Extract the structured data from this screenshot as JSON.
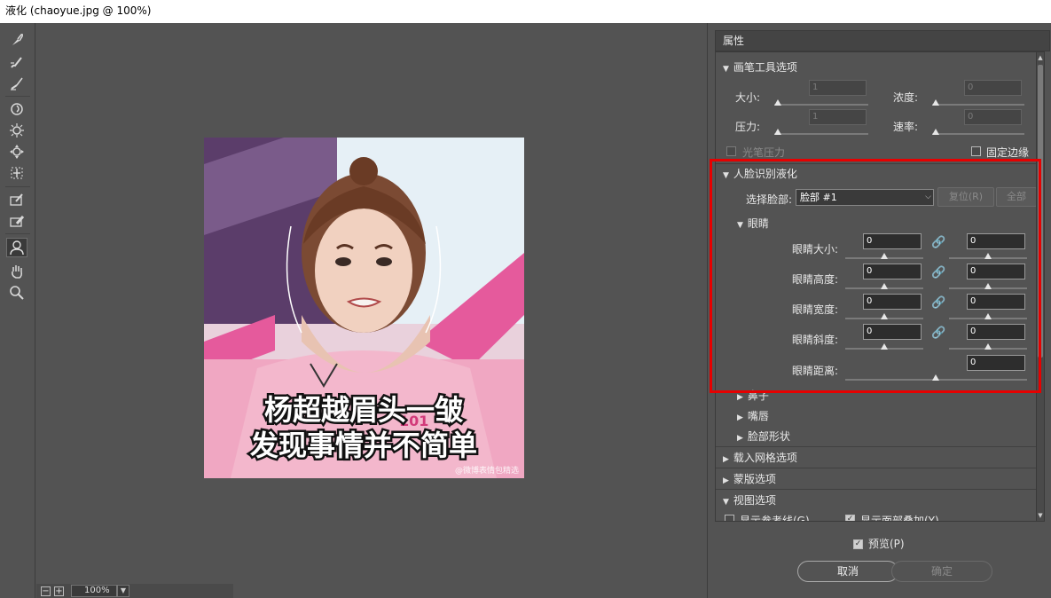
{
  "window": {
    "title": "液化 (chaoyue.jpg @ 100%)"
  },
  "toolbar": {
    "tools": [
      {
        "icon": "forward-warp-icon"
      },
      {
        "icon": "reconstruct-icon"
      },
      {
        "icon": "smooth-icon"
      },
      {
        "icon": "twirl-icon"
      },
      {
        "icon": "pucker-icon"
      },
      {
        "icon": "bloat-icon"
      },
      {
        "icon": "push-left-icon"
      },
      {
        "icon": "freeze-mask-icon"
      },
      {
        "icon": "thaw-mask-icon"
      },
      {
        "icon": "face-tool-icon",
        "active": true
      },
      {
        "icon": "hand-icon"
      },
      {
        "icon": "zoom-icon"
      }
    ]
  },
  "canvas": {
    "caption_line1": "杨超越眉头一皱",
    "caption_line2": "发现事情并不简单",
    "logo_text": "101",
    "watermark": "@微博表情包精选"
  },
  "zoom": {
    "value": "100%"
  },
  "properties": {
    "header": "属性",
    "brush_section": {
      "title": "画笔工具选项",
      "size_label": "大小:",
      "size_value": "1",
      "density_label": "浓度:",
      "density_value": "0",
      "pressure_label": "压力:",
      "pressure_value": "1",
      "rate_label": "速率:",
      "rate_value": "0",
      "stylus_label": "光笔压力",
      "pin_edges_label": "固定边缘"
    },
    "face_section": {
      "title": "人脸识别液化",
      "select_face_label": "选择脸部:",
      "select_face_value": "脸部 #1",
      "reset_label": "复位(R)",
      "all_label": "全部",
      "eyes": {
        "title": "眼睛",
        "rows": [
          {
            "label": "眼睛大小:",
            "left": "0",
            "right": "0"
          },
          {
            "label": "眼睛高度:",
            "left": "0",
            "right": "0"
          },
          {
            "label": "眼睛宽度:",
            "left": "0",
            "right": "0"
          },
          {
            "label": "眼睛斜度:",
            "left": "0",
            "right": "0"
          }
        ],
        "distance_label": "眼睛距离:",
        "distance_value": "0"
      },
      "nose_title": "鼻子",
      "mouth_title": "嘴唇",
      "face_shape_title": "脸部形状"
    },
    "load_mesh_title": "载入网格选项",
    "mask_title": "蒙版选项",
    "view_title": "视图选项",
    "show_guides_label": "显示参考线(G)",
    "show_face_overlay_label": "显示面部叠加(Y)"
  },
  "footer": {
    "preview_label": "预览(P)",
    "cancel_label": "取消",
    "ok_label": "确定"
  }
}
